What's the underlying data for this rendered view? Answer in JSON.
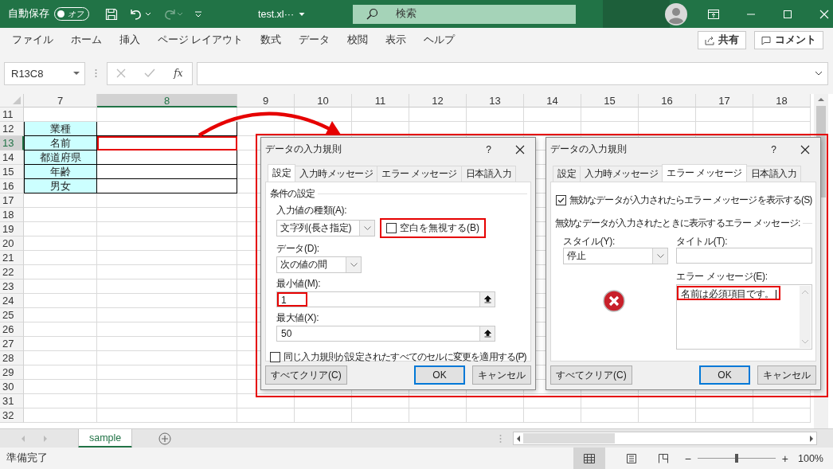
{
  "title_bar": {
    "autosave_label": "自動保存",
    "autosave_toggle": {
      "label": "オフ",
      "on": false
    },
    "redo_disabled": true,
    "file_name": "test.xl···",
    "search": {
      "placeholder": "検索"
    }
  },
  "ribbon_tabs": [
    "ファイル",
    "ホーム",
    "挿入",
    "ページ レイアウト",
    "数式",
    "データ",
    "校閲",
    "表示",
    "ヘルプ"
  ],
  "ribbon_buttons": [
    "共有",
    "コメント"
  ],
  "formula_bar": {
    "name_box": "R13C8",
    "function_label": "fx"
  },
  "sheet": {
    "columns": [
      {
        "label": "7",
        "selected": false
      },
      {
        "label": "8",
        "selected": true
      },
      {
        "label": "9",
        "selected": false
      },
      {
        "label": "10",
        "selected": false
      },
      {
        "label": "11",
        "selected": false
      },
      {
        "label": "12",
        "selected": false
      },
      {
        "label": "13",
        "selected": false
      },
      {
        "label": "14",
        "selected": false
      },
      {
        "label": "15",
        "selected": false
      },
      {
        "label": "16",
        "selected": false
      },
      {
        "label": "17",
        "selected": false
      },
      {
        "label": "18",
        "selected": false
      }
    ],
    "rows": [
      {
        "label": "11",
        "selected": false
      },
      {
        "label": "12",
        "selected": false,
        "field": "業種"
      },
      {
        "label": "13",
        "selected": true,
        "field": "名前",
        "highlighted": true
      },
      {
        "label": "14",
        "selected": false,
        "field": "都道府県"
      },
      {
        "label": "15",
        "selected": false,
        "field": "年齢"
      },
      {
        "label": "16",
        "selected": false,
        "field": "男女"
      },
      {
        "label": "17",
        "selected": false
      },
      {
        "label": "18",
        "selected": false
      },
      {
        "label": "19",
        "selected": false
      },
      {
        "label": "20",
        "selected": false
      },
      {
        "label": "21",
        "selected": false
      },
      {
        "label": "22",
        "selected": false
      },
      {
        "label": "23",
        "selected": false
      },
      {
        "label": "24",
        "selected": false
      },
      {
        "label": "25",
        "selected": false
      },
      {
        "label": "26",
        "selected": false
      },
      {
        "label": "27",
        "selected": false
      },
      {
        "label": "28",
        "selected": false
      },
      {
        "label": "29",
        "selected": false
      },
      {
        "label": "30",
        "selected": false
      },
      {
        "label": "31",
        "selected": false
      },
      {
        "label": "32",
        "selected": false
      }
    ]
  },
  "annotation": {
    "arrow": true,
    "dialogs_outlined": true
  },
  "dialogs": [
    {
      "kind": "settings",
      "title": "データの入力規則",
      "help": "?",
      "tabs": [
        {
          "label": "設定",
          "selected": true
        },
        {
          "label": "入力時メッセージ",
          "selected": false
        },
        {
          "label": "エラー メッセージ",
          "selected": false
        },
        {
          "label": "日本語入力",
          "selected": false
        }
      ],
      "section": "条件の設定",
      "allow": {
        "label": "入力値の種類(A):",
        "value": "文字列(長さ指定)"
      },
      "ignore_blank": {
        "label": "空白を無視する(B)",
        "checked": false,
        "highlighted": true
      },
      "data": {
        "label": "データ(D):",
        "value": "次の値の間"
      },
      "minimum": {
        "label": "最小値(M):",
        "value": "1",
        "highlighted": true
      },
      "maximum": {
        "label": "最大値(X):",
        "value": "50"
      },
      "apply_all": {
        "label": "同じ入力規則が設定されたすべてのセルに変更を適用する(P)",
        "checked": false
      },
      "buttons": [
        "すべてクリア(C)",
        "OK",
        "キャンセル"
      ]
    },
    {
      "kind": "error_alert",
      "title": "データの入力規則",
      "help": "?",
      "tabs": [
        {
          "label": "設定",
          "selected": false
        },
        {
          "label": "入力時メッセージ",
          "selected": false
        },
        {
          "label": "エラー メッセージ",
          "selected": true
        },
        {
          "label": "日本語入力",
          "selected": false
        }
      ],
      "show_error": {
        "label": "無効なデータが入力されたらエラー メッセージを表示する(S)",
        "checked": true
      },
      "section": "無効なデータが入力されたときに表示するエラー メッセージ:",
      "style": {
        "label": "スタイル(Y):",
        "value": "停止"
      },
      "title_field": {
        "label": "タイトル(T):"
      },
      "message": {
        "label": "エラー メッセージ(E):",
        "value": "名前は必須項目です。",
        "highlighted": true
      },
      "buttons": [
        "すべてクリア(C)",
        "OK",
        "キャンセル"
      ]
    }
  ],
  "sheet_tabs": [
    {
      "label": "sample",
      "selected": true
    }
  ],
  "status_bar": {
    "status": "準備完了",
    "zoom_out": "−",
    "zoom_in": "+",
    "zoom": {
      "level": 0.5
    },
    "zoom_label": "100%"
  }
}
